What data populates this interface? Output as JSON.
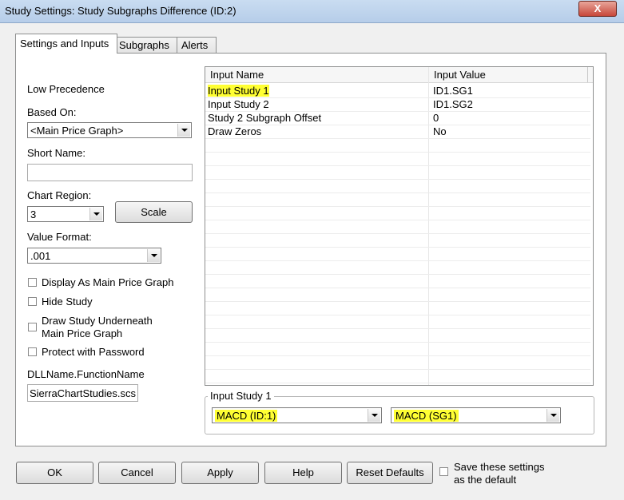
{
  "window": {
    "title": "Study Settings: Study Subgraphs Difference (ID:2)",
    "close_label": "X"
  },
  "tabs": [
    {
      "label": "Settings and Inputs"
    },
    {
      "label": "Subgraphs"
    },
    {
      "label": "Alerts"
    }
  ],
  "left": {
    "precedence_label": "Low Precedence",
    "based_on_label": "Based On:",
    "based_on_value": "<Main Price Graph>",
    "short_name_label": "Short Name:",
    "short_name_value": "",
    "chart_region_label": "Chart Region:",
    "chart_region_value": "3",
    "scale_button": "Scale",
    "value_format_label": "Value Format:",
    "value_format_value": ".001",
    "checkboxes": [
      {
        "label": "Display As Main Price Graph",
        "checked": false
      },
      {
        "label": "Hide Study",
        "checked": false
      },
      {
        "label": "Draw Study Underneath\nMain Price Graph",
        "checked": false
      },
      {
        "label": "Protect with Password",
        "checked": false
      }
    ],
    "dll_label": "DLLName.FunctionName",
    "dll_value": "SierraChartStudies.scs"
  },
  "grid": {
    "col_name": "Input Name",
    "col_value": "Input Value",
    "rows": [
      {
        "name": "Input Study 1",
        "value": "ID1.SG1"
      },
      {
        "name": "Input Study 2",
        "value": "ID1.SG2"
      },
      {
        "name": "Study 2 Subgraph Offset",
        "value": "0"
      },
      {
        "name": "Draw Zeros",
        "value": "No"
      }
    ]
  },
  "input_group": {
    "title": "Input Study 1",
    "study_value": "MACD (ID:1)",
    "subgraph_value": "MACD (SG1)"
  },
  "bottom": {
    "ok": "OK",
    "cancel": "Cancel",
    "apply": "Apply",
    "help": "Help",
    "reset": "Reset Defaults",
    "save_default_label": "Save these settings\nas the default"
  },
  "colors": {
    "highlight": "#ffff33"
  }
}
